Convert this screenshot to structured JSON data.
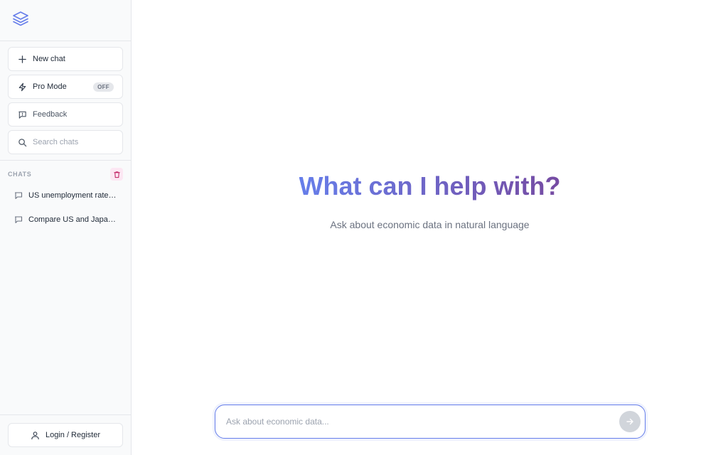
{
  "sidebar": {
    "logo_icon": "layers-icon",
    "nav": {
      "new_chat": {
        "label": "New chat",
        "icon": "plus-icon"
      },
      "pro_mode": {
        "label": "Pro Mode",
        "icon": "bolt-icon",
        "badge": "OFF"
      },
      "feedback": {
        "label": "Feedback",
        "icon": "message-square-icon"
      },
      "search": {
        "placeholder": "Search chats",
        "icon": "search-icon"
      }
    },
    "chats_title": "CHATS",
    "chats": [
      {
        "title": "US unemployment rate a..."
      },
      {
        "title": "Compare US and Japan ..."
      }
    ],
    "footer": {
      "login_label": "Login / Register",
      "icon": "user-icon"
    }
  },
  "main": {
    "title": "What can I help with?",
    "subtitle": "Ask about economic data in natural language",
    "composer": {
      "placeholder": "Ask about economic data...",
      "value": ""
    }
  },
  "colors": {
    "accent_start": "#667eea",
    "accent_end": "#764ba2",
    "sidebar_bg": "#f9fafb",
    "border": "#e5e7eb"
  }
}
